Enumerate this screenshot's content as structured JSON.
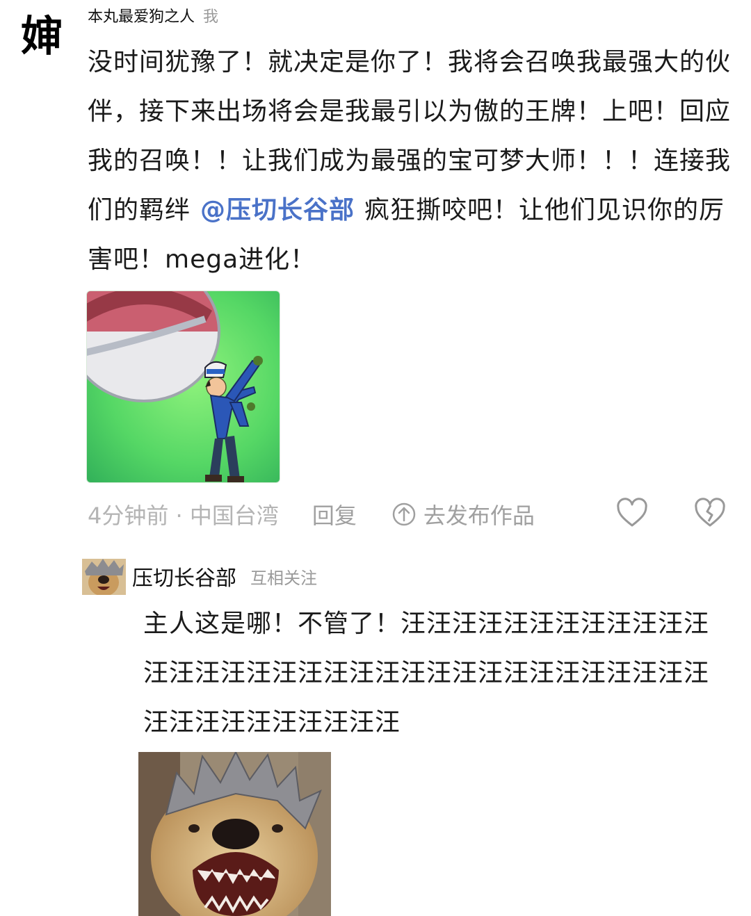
{
  "comment": {
    "avatar_char": "婶",
    "username": "本丸最爱狗之人",
    "self_tag": "我",
    "text_before_mention": "没时间犹豫了！就决定是你了！我将会召唤我最强大的伙伴，接下来出场将会是我最引以为傲的王牌！上吧！回应我的召唤！！让我们成为最强的宝可梦大师！！！连接我们的羁绊",
    "mention": "@压切长谷部",
    "text_after_mention": "疯狂撕咬吧！让他们见识你的厉害吧！mega进化！",
    "meta": "4分钟前 · 中国台湾",
    "reply_label": "回复",
    "publish_label": "去发布作品",
    "like_icon": "heart-outline-icon",
    "dislike_icon": "broken-heart-outline-icon"
  },
  "reply": {
    "username": "压切长谷部",
    "relation_tag": "互相关注",
    "text": "主人这是哪！不管了！汪汪汪汪汪汪汪汪汪汪汪汪汪汪汪汪汪汪汪汪汪汪汪汪汪汪汪汪汪汪汪汪汪汪汪汪汪汪汪汪汪汪汪汪"
  },
  "colors": {
    "mention": "#4a72c8",
    "meta_text": "#b4b4b4",
    "image_green": "#5fd86a"
  }
}
